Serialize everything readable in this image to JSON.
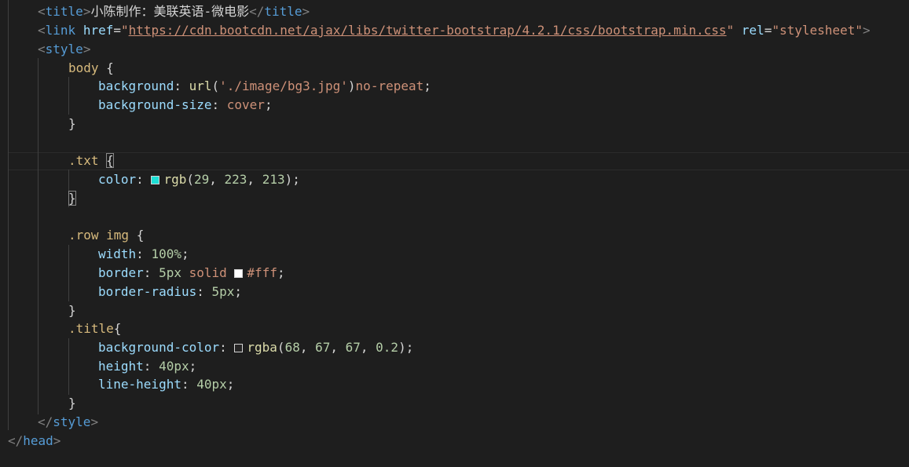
{
  "editor": {
    "lines": {
      "title": {
        "open_bracket": "<",
        "tag": "title",
        "close_bracket": ">",
        "text": "小陈制作：美联英语-微电影",
        "end_open": "</",
        "end_tag": "title",
        "end_close": ">"
      },
      "link": {
        "open_bracket": "<",
        "tag": "link",
        "attr_href": "href",
        "eq1": "=",
        "quote_open": "\"",
        "url": "https://cdn.bootcdn.net/ajax/libs/twitter-bootstrap/4.2.1/css/bootstrap.min.css",
        "quote_close": "\"",
        "attr_rel": "rel",
        "eq2": "=",
        "rel_value": "\"stylesheet\"",
        "close_bracket": ">"
      },
      "style_open": {
        "open_bracket": "<",
        "tag": "style",
        "close_bracket": ">"
      },
      "body_selector": {
        "selector": "body",
        "brace": "{"
      },
      "body_bg": {
        "prop": "background",
        "colon": ": ",
        "fn": "url",
        "paren_open": "(",
        "str": "'./image/bg3.jpg'",
        "paren_close": ")",
        "kw": "no-repeat",
        "semi": ";"
      },
      "body_bg_size": {
        "prop": "background-size",
        "colon": ": ",
        "kw": "cover",
        "semi": ";"
      },
      "body_close": {
        "brace": "}"
      },
      "txt_selector": {
        "selector": ".txt",
        "brace": "{"
      },
      "txt_color": {
        "prop": "color",
        "colon": ": ",
        "swatch_color": "#1ddfd5",
        "fn": "rgb",
        "paren_open": "(",
        "n1": "29",
        "sep1": ", ",
        "n2": "223",
        "sep2": ", ",
        "n3": "213",
        "paren_close": ")",
        "semi": ";"
      },
      "txt_close": {
        "brace": "}"
      },
      "row_img_selector": {
        "selector": ".row img",
        "brace": "{"
      },
      "row_width": {
        "prop": "width",
        "colon": ": ",
        "num": "100%",
        "semi": ";"
      },
      "row_border": {
        "prop": "border",
        "colon": ": ",
        "num": "5px",
        "kw": "solid",
        "swatch_color": "#ffffff",
        "value": "#fff",
        "semi": ";"
      },
      "row_radius": {
        "prop": "border-radius",
        "colon": ": ",
        "num": "5px",
        "semi": ";"
      },
      "row_close": {
        "brace": "}"
      },
      "title_selector": {
        "selector": ".title",
        "brace": "{"
      },
      "title_bg": {
        "prop": "background-color",
        "colon": ": ",
        "swatch_color": "rgba(68, 67, 67, 0.2)",
        "fn": "rgba",
        "paren_open": "(",
        "n1": "68",
        "sep1": ", ",
        "n2": "67",
        "sep2": ", ",
        "n3": "67",
        "sep3": ", ",
        "n4": "0.2",
        "paren_close": ")",
        "semi": ";"
      },
      "title_height": {
        "prop": "height",
        "colon": ": ",
        "num": "40px",
        "semi": ";"
      },
      "title_line_height": {
        "prop": "line-height",
        "colon": ": ",
        "num": "40px",
        "semi": ";"
      },
      "title_close": {
        "brace": "}"
      },
      "style_close": {
        "open_bracket": "</",
        "tag": "style",
        "close_bracket": ">"
      },
      "head_close": {
        "open_bracket": "</",
        "tag": "head",
        "close_bracket": ">"
      }
    }
  }
}
